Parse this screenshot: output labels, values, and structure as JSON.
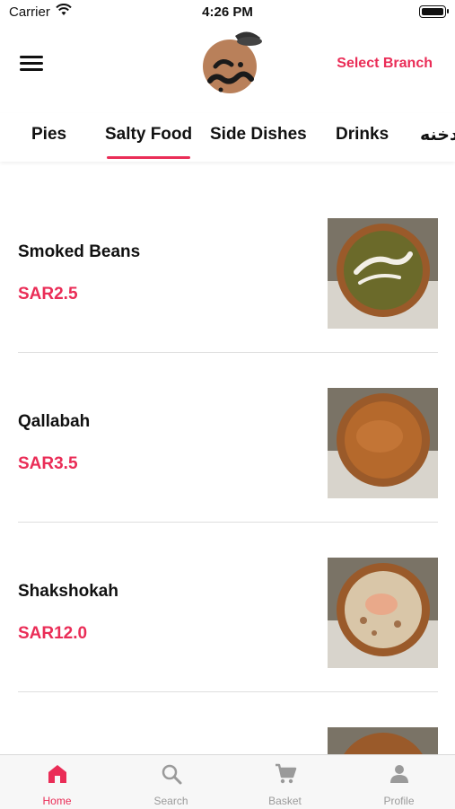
{
  "status_bar": {
    "carrier": "Carrier",
    "time": "4:26 PM"
  },
  "header": {
    "menu_icon": "hamburger-menu-icon",
    "logo": "restaurant-logo",
    "select_branch": "Select Branch"
  },
  "tabs": [
    {
      "label": "Pies"
    },
    {
      "label": "Salty Food",
      "active": true
    },
    {
      "label": "Side Dishes"
    },
    {
      "label": "Drinks"
    },
    {
      "label": "دخنه"
    }
  ],
  "items": [
    {
      "name": "Smoked Beans",
      "price": "SAR2.5"
    },
    {
      "name": "Qallabah",
      "price": "SAR3.5"
    },
    {
      "name": "Shakshokah",
      "price": "SAR12.0"
    }
  ],
  "tab_bar": [
    {
      "label": "Home",
      "icon": "home-icon",
      "active": true
    },
    {
      "label": "Search",
      "icon": "search-icon"
    },
    {
      "label": "Basket",
      "icon": "cart-icon"
    },
    {
      "label": "Profile",
      "icon": "profile-icon"
    }
  ],
  "colors": {
    "accent": "#ea2d57",
    "inactive": "#9a9a9a"
  }
}
